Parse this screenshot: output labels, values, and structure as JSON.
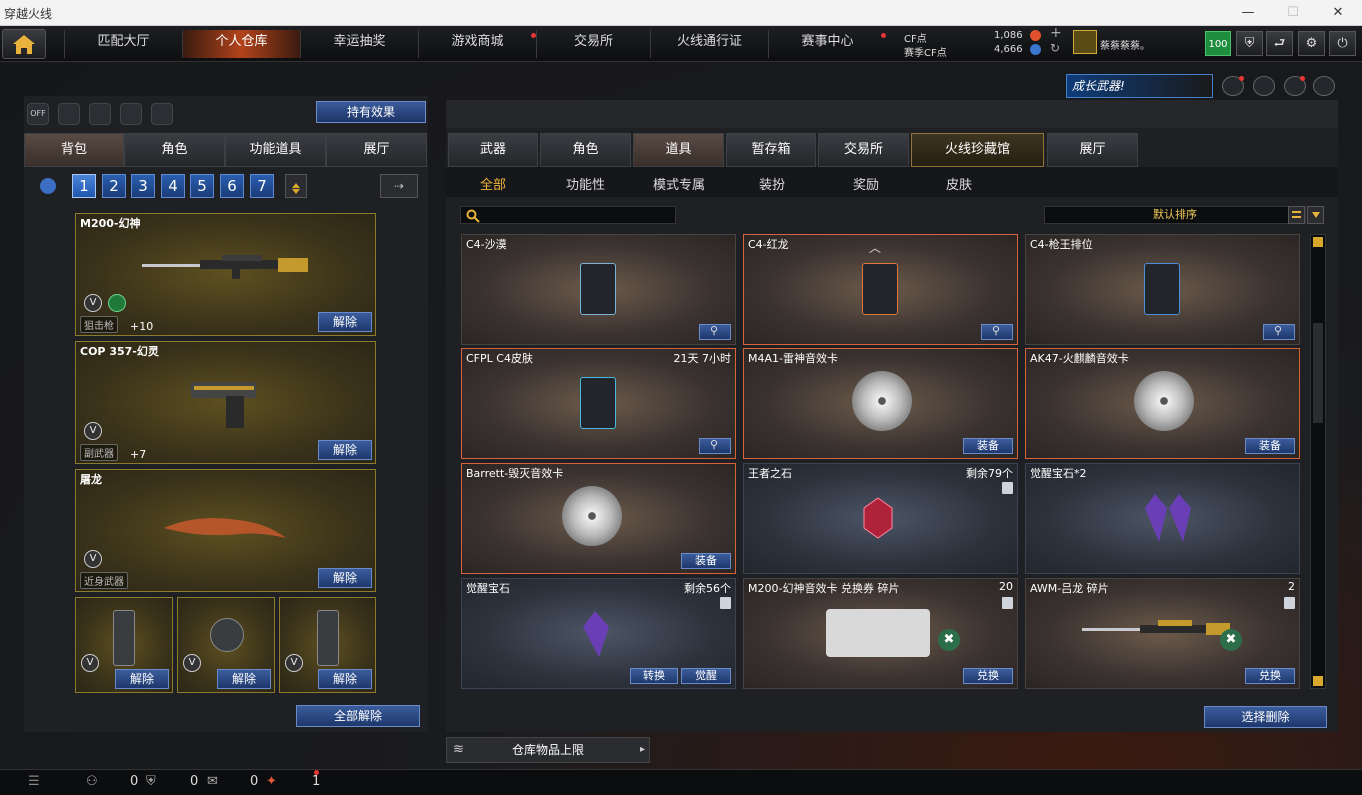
{
  "window": {
    "title": "穿越火线",
    "min": "—",
    "max": "☐",
    "close": "✕"
  },
  "nav": {
    "items": [
      {
        "label": "匹配大厅",
        "dot": false
      },
      {
        "label": "个人仓库",
        "dot": false
      },
      {
        "label": "幸运抽奖",
        "dot": false
      },
      {
        "label": "游戏商城",
        "dot": true
      },
      {
        "label": "交易所",
        "dot": false
      },
      {
        "label": "火线通行证",
        "dot": false
      },
      {
        "label": "赛事中心",
        "dot": true
      }
    ],
    "cf_label": "CF点",
    "cf_value": "1,086",
    "match_cf_label": "赛季CF点",
    "match_cf_value": "4,666",
    "player_name": "蔡蔡蔡蔡。",
    "level": "100"
  },
  "banner": {
    "text": "成长武器!"
  },
  "left": {
    "effect_button": "持有效果",
    "off_label": "OFF",
    "tabs": [
      "背包",
      "角色",
      "功能道具",
      "展厅"
    ],
    "pages": [
      "1",
      "2",
      "3",
      "4",
      "5",
      "6",
      "7"
    ],
    "slots": [
      {
        "name": "M200-幻神",
        "category": "狙击枪",
        "bonus": "+10",
        "button": "解除"
      },
      {
        "name": "COP 357-幻灵",
        "category": "副武器",
        "bonus": "+7",
        "button": "解除"
      },
      {
        "name": "屠龙",
        "category": "近身武器",
        "bonus": "",
        "button": "解除"
      }
    ],
    "grenades": [
      {
        "button": "解除"
      },
      {
        "button": "解除"
      },
      {
        "button": "解除"
      }
    ],
    "unequip_all": "全部解除",
    "v_icon": "V"
  },
  "right": {
    "tabs": [
      "武器",
      "角色",
      "道具",
      "暂存箱",
      "交易所",
      "火线珍藏馆",
      "展厅"
    ],
    "subtabs": [
      "全部",
      "功能性",
      "模式专属",
      "装扮",
      "奖励",
      "皮肤"
    ],
    "sort_label": "默认排序",
    "items": [
      {
        "name": "C4-沙漠",
        "right": "",
        "buttons": [],
        "magnify": true
      },
      {
        "name": "C4-红龙",
        "right": "",
        "buttons": [],
        "magnify": true
      },
      {
        "name": "C4-枪王排位",
        "right": "",
        "buttons": [],
        "magnify": true
      },
      {
        "name": "CFPL C4皮肤",
        "right": "21天 7小时",
        "buttons": [],
        "magnify": true
      },
      {
        "name": "M4A1-雷神音效卡",
        "right": "",
        "buttons": [
          "装备"
        ],
        "magnify": false
      },
      {
        "name": "AK47-火麒麟音效卡",
        "right": "",
        "buttons": [
          "装备"
        ],
        "magnify": false
      },
      {
        "name": "Barrett-毁灭音效卡",
        "right": "",
        "buttons": [
          "装备"
        ],
        "magnify": false
      },
      {
        "name": "王者之石",
        "right": "剩余79个",
        "buttons": [],
        "magnify": false
      },
      {
        "name": "觉醒宝石*2",
        "right": "",
        "buttons": [],
        "magnify": false
      },
      {
        "name": "觉醒宝石",
        "right": "剩余56个",
        "buttons": [
          "转换",
          "觉醒"
        ],
        "magnify": false
      },
      {
        "name": "M200-幻神音效卡 兑换券 碎片",
        "right": "20",
        "buttons": [
          "兑换"
        ],
        "magnify": false
      },
      {
        "name": "AWM-吕龙 碎片",
        "right": "2",
        "buttons": [
          "兑换"
        ],
        "magnify": false
      }
    ],
    "select_delete": "选择删除",
    "capacity": "仓库物品上限"
  },
  "status": {
    "count1": "0",
    "count2": "0",
    "count3": "0",
    "count4": "1"
  },
  "colors": {
    "accent": "#d9a72c",
    "tab_active": "#b2431b",
    "button_blue": "#2b4a8a"
  }
}
